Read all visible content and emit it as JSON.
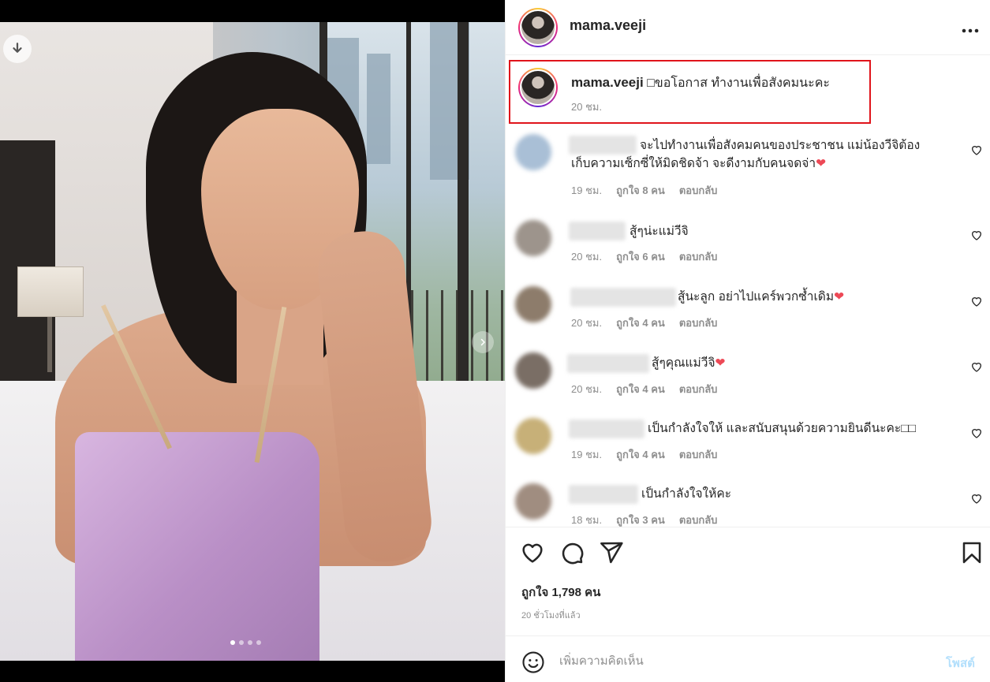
{
  "post": {
    "username": "mama.veeji",
    "more_icon": "more-horizontal-icon",
    "caption": "□ขอโอกาส ทำงานเพื่อสังคมนะคะ",
    "caption_time": "20 ชม.",
    "likes": "ถูกใจ 1,798 คน",
    "posted_time": "20 ชั่วโมงที่แล้ว"
  },
  "media": {
    "download_icon": "download-arrow-icon",
    "next_icon": "chevron-right-icon",
    "slide_count": 4,
    "active_slide": 1
  },
  "comments": [
    {
      "text_line1": "จะไปทำงานเพื่อสังคมคนของประชาชน แม่น้องวีจิต้อง",
      "text_line2": "เก็บความเซ็กซี่ให้มิดชิดจ้า จะดีงามกับคนจดจ่า",
      "time": "19 ชม.",
      "likes": "ถูกใจ 8 คน",
      "reply": "ตอบกลับ",
      "emoji": "red-heart"
    },
    {
      "text_line1": "สู้ๆน่ะแม่วีจิ",
      "text_line2": "",
      "time": "20 ชม.",
      "likes": "ถูกใจ 6 คน",
      "reply": "ตอบกลับ",
      "emoji": ""
    },
    {
      "text_line1": "สู้นะลูก อย่าไปแคร์พวกซ้ำเดิม",
      "text_line2": "",
      "time": "20 ชม.",
      "likes": "ถูกใจ 4 คน",
      "reply": "ตอบกลับ",
      "emoji": "red-heart"
    },
    {
      "text_line1": "สู้ๆคุณแม่วีจิ",
      "text_line2": "",
      "time": "20 ชม.",
      "likes": "ถูกใจ 4 คน",
      "reply": "ตอบกลับ",
      "emoji": "red-heart"
    },
    {
      "text_line1": "เป็นกำลังใจให้ และสนับสนุนด้วยความยินดีนะคะ□□",
      "text_line2": "",
      "time": "19 ชม.",
      "likes": "ถูกใจ 4 คน",
      "reply": "ตอบกลับ",
      "emoji": ""
    },
    {
      "text_line1": "เป็นกำลังใจให้คะ",
      "text_line2": "",
      "time": "18 ชม.",
      "likes": "ถูกใจ 3 คน",
      "reply": "ตอบกลับ",
      "emoji": ""
    }
  ],
  "actions": {
    "like_icon": "heart-outline-icon",
    "comment_icon": "comment-bubble-icon",
    "share_icon": "paper-plane-icon",
    "save_icon": "bookmark-icon"
  },
  "composer": {
    "emoji_icon": "smiley-icon",
    "placeholder": "เพิ่มความคิดเห็น",
    "post_label": "โพสต์"
  },
  "colors": {
    "highlight_border": "#e0141b",
    "muted_text": "#8e8e8e",
    "post_button": "#b2dffc",
    "heart_red": "#ed4956"
  }
}
